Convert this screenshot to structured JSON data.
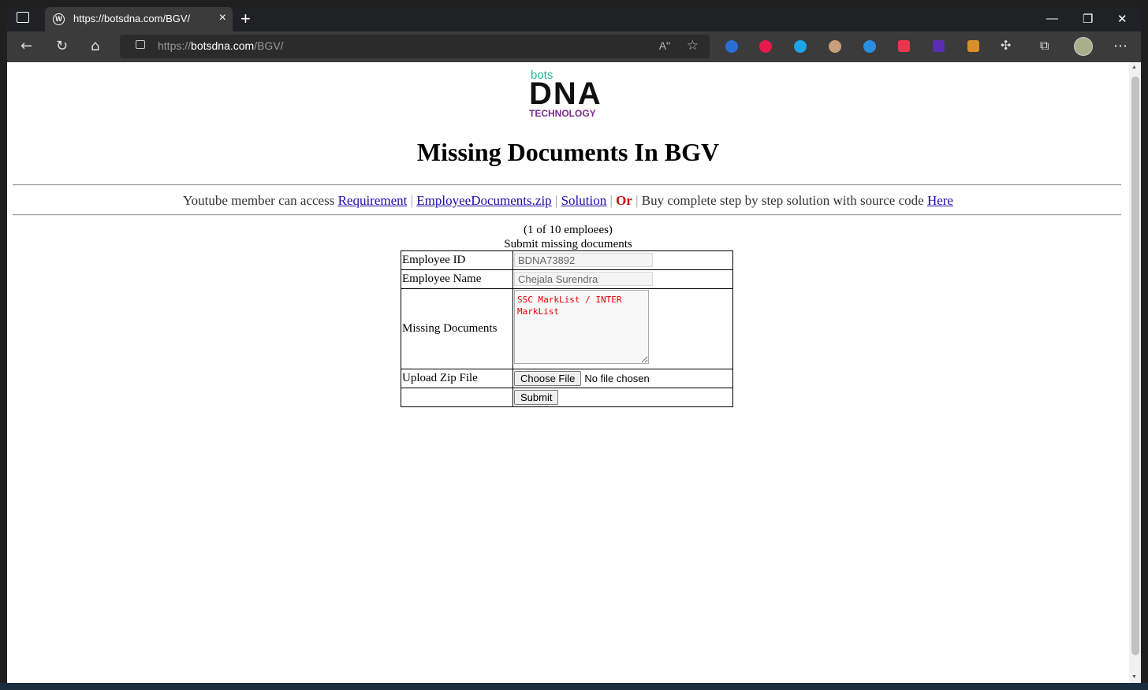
{
  "browser": {
    "tab_title": "https://botsdna.com/BGV/",
    "url_scheme": "https://",
    "url_domain": "botsdna.com",
    "url_path": "/BGV/",
    "read_aloud": "Aʺ"
  },
  "logo": {
    "top": "bots",
    "middle": "DNA",
    "bottom": "TECHNOLOGY"
  },
  "page": {
    "title": "Missing Documents In BGV",
    "links_intro": "Youtube member can access",
    "link_requirement": "Requirement",
    "link_zip": "EmployeeDocuments.zip",
    "link_solution": "Solution",
    "or": "Or",
    "buy_text": "Buy complete step by step solution with source code",
    "link_here": "Here",
    "pipe": "|",
    "counter": "(1 of 10 emploees)",
    "subtitle": "Submit missing documents"
  },
  "form": {
    "employee_id_label": "Employee ID",
    "employee_id_value": "BDNA73892",
    "employee_name_label": "Employee Name",
    "employee_name_value": "Chejala Surendra",
    "missing_docs_label": "Missing Documents",
    "missing_docs_value": "SSC MarkList / INTER MarkList",
    "upload_label": "Upload Zip File",
    "choose_file": "Choose File",
    "no_file": "No file chosen",
    "submit": "Submit"
  }
}
